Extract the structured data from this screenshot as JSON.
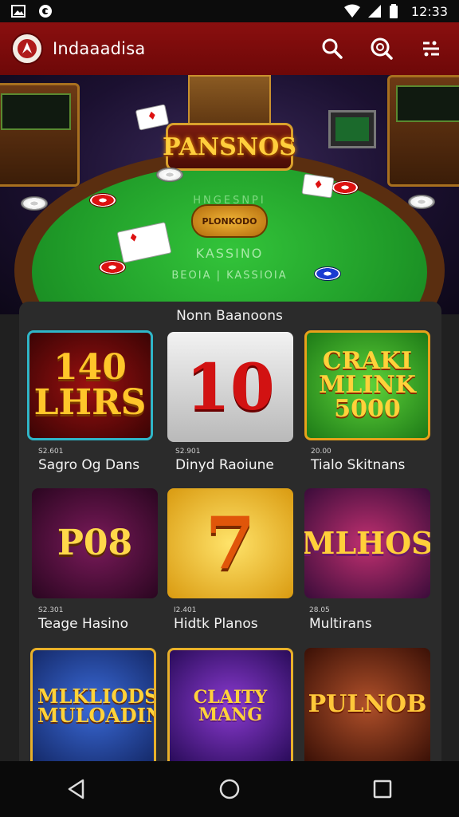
{
  "status_bar": {
    "time": "12:33",
    "left_icons": [
      "photo-icon",
      "notification-app-icon"
    ],
    "right_icons": [
      "wifi-icon",
      "signal-icon",
      "battery-icon"
    ]
  },
  "header": {
    "app_title": "Indaaadisa",
    "actions": [
      "search-icon",
      "zoom-icon",
      "menu-icon"
    ],
    "color": "#7d0c0c"
  },
  "hero": {
    "sign_title": "PANSNOS",
    "felt_top": "HNGESNPI",
    "badge": "PLONKODO",
    "felt_sub": "KASSINO",
    "felt_foot": "BEOIA | KASSIOIA"
  },
  "section": {
    "title": "Nonn Baanoons"
  },
  "games": [
    {
      "art": "140 LHRS",
      "small": "S2.601",
      "name": "Sagro Og Dans"
    },
    {
      "art": "10",
      "small": "S2.901",
      "name": "Dinyd Raoiune"
    },
    {
      "art": "CRAKI MLINK 5000",
      "small": "20.00",
      "name": "Tialo Skitnans"
    },
    {
      "art": "P08",
      "small": "S2.301",
      "name": "Teage Hasino"
    },
    {
      "art": "7",
      "small": "I2.401",
      "name": "Hidtk Planos"
    },
    {
      "art": "MLHOS",
      "small": "28.05",
      "name": "Multirans"
    },
    {
      "art": "MLKLIODS MULOADINS",
      "small": "",
      "name": ""
    },
    {
      "art": "CLAITY MANG",
      "small": "",
      "name": ""
    },
    {
      "art": "PULNOB",
      "small": "",
      "name": ""
    }
  ],
  "nav": {
    "buttons": [
      "back-icon",
      "home-icon",
      "recents-icon"
    ]
  }
}
